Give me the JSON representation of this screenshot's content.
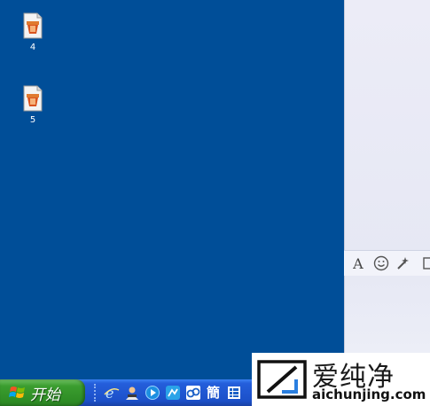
{
  "desktop": {
    "icons": [
      {
        "label": "4",
        "icon": "shortcut-file-icon"
      },
      {
        "label": "5",
        "icon": "shortcut-file-icon"
      }
    ]
  },
  "chat_toolbar": {
    "font_glyph": "A",
    "items": [
      "font-icon",
      "emoji-icon",
      "magic-wand-icon"
    ]
  },
  "taskbar": {
    "start_label": "开始",
    "quicklaunch": [
      "ie-icon",
      "user-icon",
      "media-icon",
      "app-icon",
      "network-icon",
      "text-app-icon",
      "list-app-icon"
    ],
    "text_app_glyph": "簡"
  },
  "watermark": {
    "brand": "爱纯净",
    "url": "aichunjing.com"
  },
  "colors": {
    "desktop": "#004e98",
    "taskbar": "#245edb",
    "start": "#3b9d2f"
  }
}
